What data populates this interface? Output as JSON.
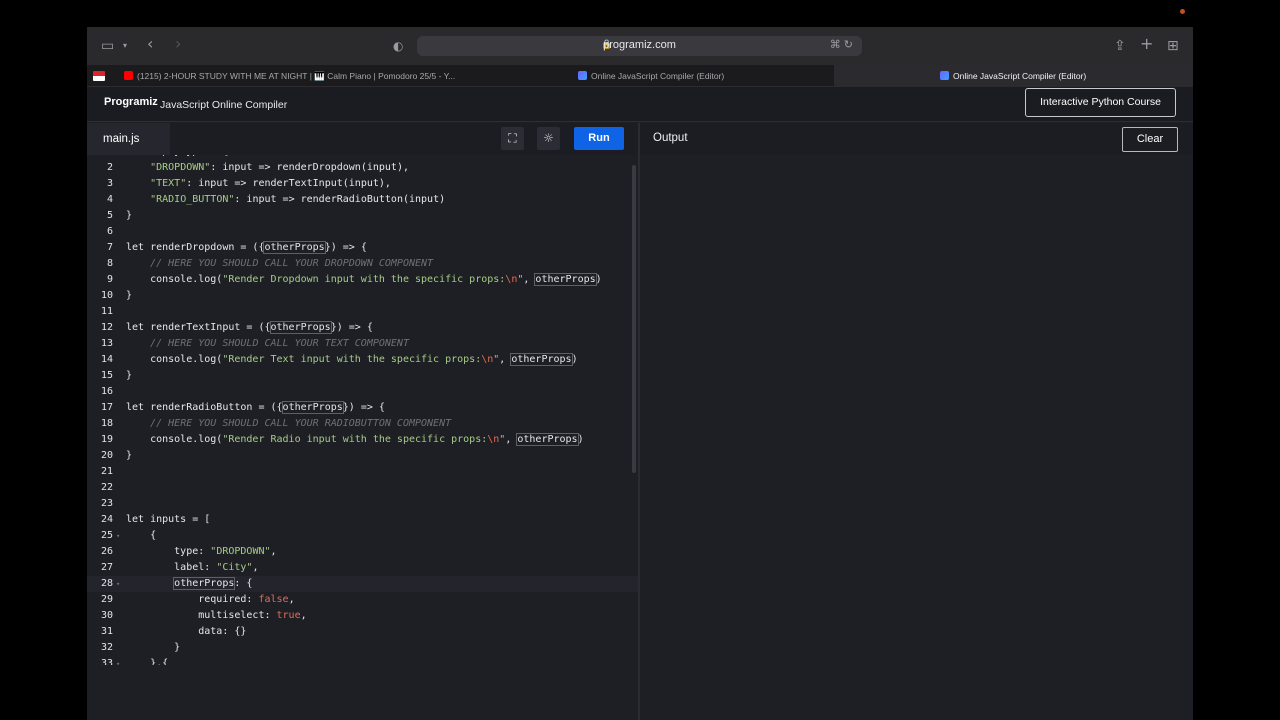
{
  "browser": {
    "url": "programiz.com",
    "icons": [
      "sidebar-icon",
      "chevron-down-icon",
      "back-icon",
      "forward-icon",
      "shield-icon",
      "lock-icon",
      "translate-icon",
      "reload-icon",
      "share-icon",
      "new-tab-icon",
      "tab-overview-icon"
    ],
    "tabs": [
      {
        "label": "(1215) 2-HOUR STUDY WITH ME AT NIGHT | 🎹 Calm Piano | Pomodoro 25/5 - Y...",
        "active": false
      },
      {
        "label": "Online JavaScript Compiler (Editor)",
        "active": false
      },
      {
        "label": "Online JavaScript Compiler (Editor)",
        "active": true
      }
    ]
  },
  "header": {
    "logo": "Programiz",
    "title": "JavaScript Online Compiler",
    "course_button": "Interactive Python Course"
  },
  "editor": {
    "file_tab": "main.js",
    "fullscreen_icon": "⛶",
    "theme_icon": "☼",
    "run_label": "Run"
  },
  "output": {
    "title": "Output",
    "clear_label": "Clear"
  }
}
